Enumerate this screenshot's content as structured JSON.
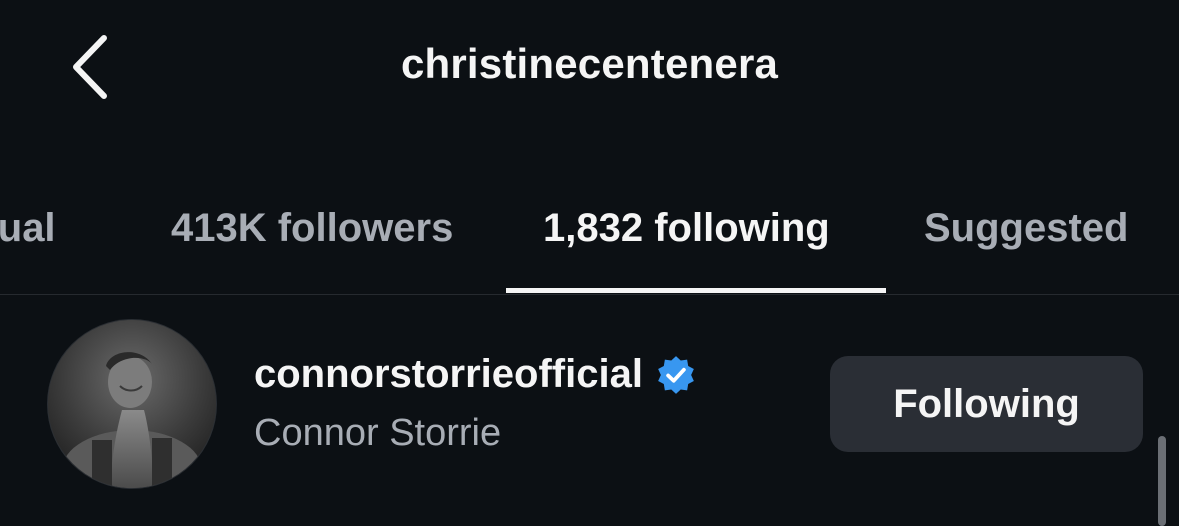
{
  "header": {
    "title": "christinecentenera",
    "back_icon": "chevron-left-icon"
  },
  "tabs": [
    {
      "label": "Mutual",
      "visible_text": "utual",
      "active": false
    },
    {
      "label": "413K followers",
      "active": false
    },
    {
      "label": "1,832 following",
      "active": true
    },
    {
      "label": "Suggested",
      "active": false
    }
  ],
  "list": {
    "items": [
      {
        "username": "connorstorrieofficial",
        "full_name": "Connor Storrie",
        "verified": true,
        "verified_icon": "verified-badge-icon",
        "button_label": "Following"
      }
    ]
  },
  "colors": {
    "background": "#0c1014",
    "primary_text": "#f5f5f5",
    "secondary_text": "#a8adb5",
    "button_bg": "#2a2e35",
    "verified_blue": "#3897f0"
  }
}
